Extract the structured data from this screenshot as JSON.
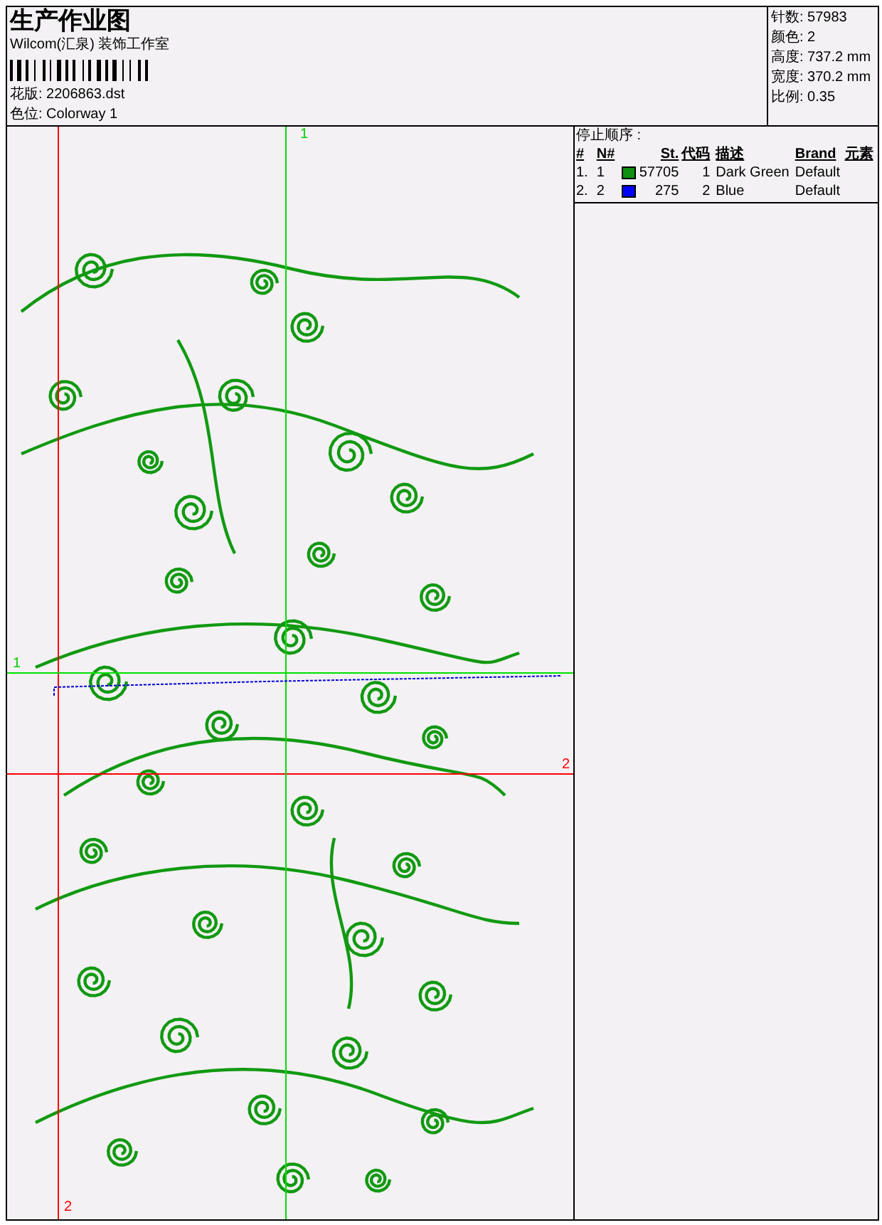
{
  "title": "生产作业图",
  "company": "Wilcom(汇泉) 装饰工作室",
  "design_file": {
    "label": "花版:",
    "value": "2206863.dst"
  },
  "colorway": {
    "label": "色位:",
    "value": "Colorway 1"
  },
  "stats": [
    {
      "label": "针数:",
      "value": "57983"
    },
    {
      "label": "颜色:",
      "value": "2"
    },
    {
      "label": "高度:",
      "value": "737.2 mm"
    },
    {
      "label": "宽度:",
      "value": "370.2 mm"
    },
    {
      "label": "比例:",
      "value": "0.35"
    }
  ],
  "stop_sequence": {
    "title": "停止顺序 :",
    "columns": [
      "#",
      "N#",
      "St.",
      "代码",
      "描述",
      "Brand",
      "元素"
    ],
    "rows": [
      {
        "index": "1.",
        "number": "1",
        "color": "#109010",
        "stitches": "57705",
        "code": "1",
        "description": "Dark Green",
        "brand": "Default"
      },
      {
        "index": "2.",
        "number": "2",
        "color": "#0000ff",
        "stitches": "275",
        "code": "2",
        "description": "Blue",
        "brand": "Default"
      }
    ]
  },
  "guides": [
    {
      "kind": "green",
      "label": "1"
    },
    {
      "kind": "green",
      "label": "1"
    },
    {
      "kind": "red",
      "label": "2"
    },
    {
      "kind": "red",
      "label": "2"
    }
  ]
}
